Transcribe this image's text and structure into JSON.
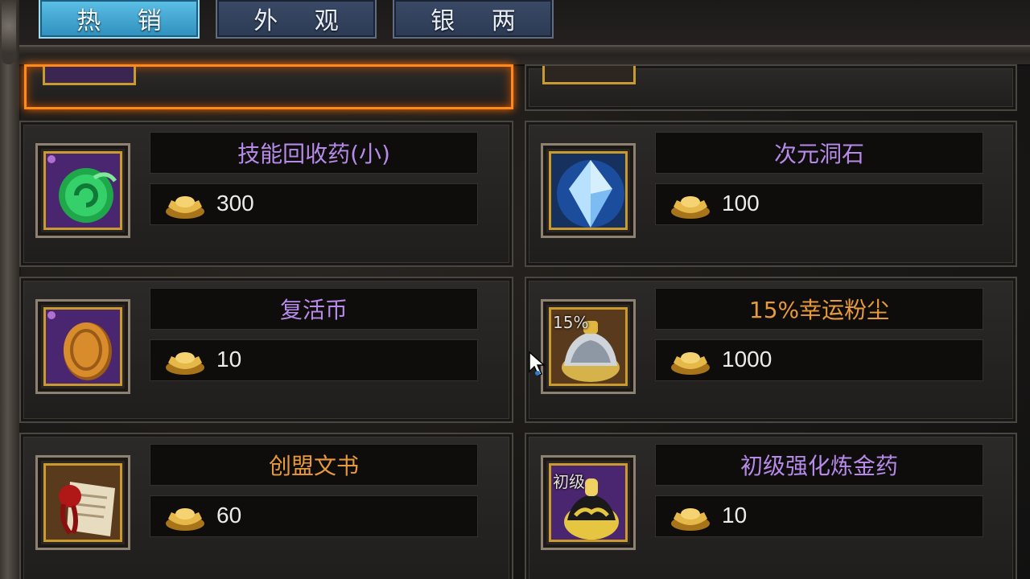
{
  "tabs": [
    {
      "label": "热 销",
      "active": true
    },
    {
      "label": "外 观",
      "active": false
    },
    {
      "label": "银 两",
      "active": false
    }
  ],
  "colors": {
    "name_purple": "#b68ae8",
    "name_orange": "#e89a3a",
    "selected_border": "#ff8a1a",
    "active_tab": "#4fb3dd"
  },
  "items": [
    {
      "name": "技能回收药(小)",
      "price": "300",
      "name_color": "purple",
      "icon": "green-orb-icon"
    },
    {
      "name": "次元洞石",
      "price": "100",
      "name_color": "purple",
      "icon": "blue-crystal-icon"
    },
    {
      "name": "复活币",
      "price": "10",
      "name_color": "purple",
      "icon": "gold-coin-icon"
    },
    {
      "name": "15%幸运粉尘",
      "price": "1000",
      "name_color": "orange",
      "icon": "dust-pouch-icon",
      "overlay": "15%"
    },
    {
      "name": "创盟文书",
      "price": "60",
      "name_color": "orange",
      "icon": "scroll-seal-icon"
    },
    {
      "name": "初级强化炼金药",
      "price": "10",
      "name_color": "purple",
      "icon": "alchemy-potion-icon",
      "overlay": "初级"
    }
  ],
  "currency_icon": "gold-ingot-icon"
}
